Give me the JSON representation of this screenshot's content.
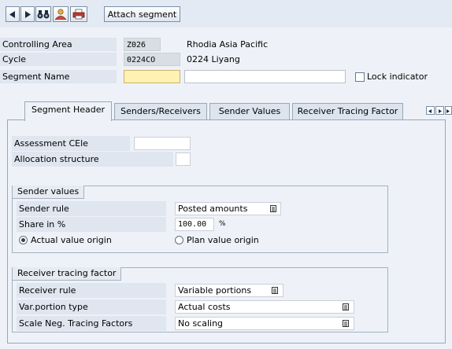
{
  "toolbar": {
    "attach_label": "Attach segment"
  },
  "header": {
    "controlling_area_label": "Controlling Area",
    "controlling_area_value": "Z026",
    "controlling_area_text": "Rhodia Asia Pacific",
    "cycle_label": "Cycle",
    "cycle_value": "0224CO",
    "cycle_text": "0224 Liyang",
    "segment_name_label": "Segment Name",
    "segment_name_value": "",
    "lock_label": "Lock indicator"
  },
  "tabs": [
    {
      "label": "Segment Header"
    },
    {
      "label": "Senders/Receivers"
    },
    {
      "label": "Sender Values"
    },
    {
      "label": "Receiver Tracing Factor"
    }
  ],
  "segment_header": {
    "assessment_label": "Assessment CEle",
    "assessment_value": "",
    "allocation_label": "Allocation structure",
    "allocation_value": ""
  },
  "sender_values": {
    "title": "Sender values",
    "sender_rule_label": "Sender rule",
    "sender_rule_value": "Posted amounts",
    "share_label": "Share in %",
    "share_value": "100.00",
    "share_unit": "%",
    "actual_label": "Actual value origin",
    "plan_label": "Plan value origin"
  },
  "receiver_tracing": {
    "title": "Receiver tracing factor",
    "receiver_rule_label": "Receiver rule",
    "receiver_rule_value": "Variable portions",
    "var_portion_label": "Var.portion type",
    "var_portion_value": "Actual costs",
    "scale_label": "Scale Neg. Tracing Factors",
    "scale_value": "No scaling"
  }
}
